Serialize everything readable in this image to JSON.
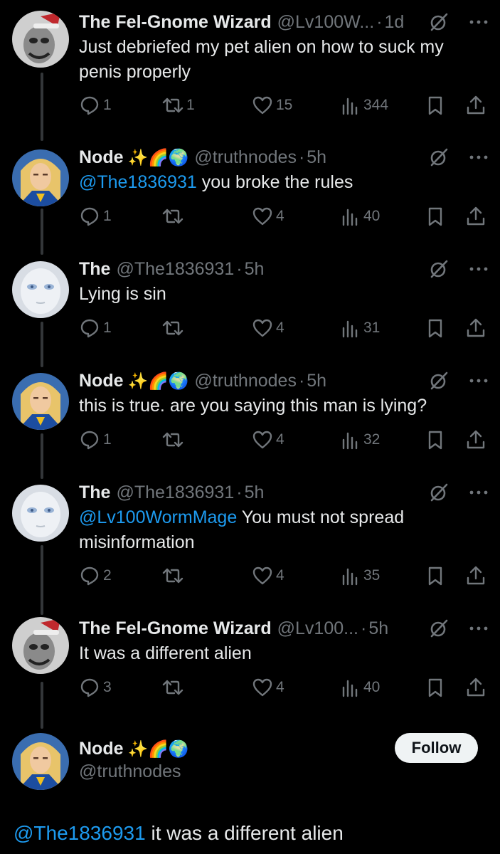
{
  "tweets": [
    {
      "avatar": "goblin-avatar",
      "name": "The Fel-Gnome Wizard",
      "emoji": "",
      "handle": "@Lv100W...",
      "time": "1d",
      "mention": "",
      "text": "Just debriefed my pet alien on how to suck my penis properly",
      "replies": "1",
      "reposts": "1",
      "likes": "15",
      "views": "344"
    },
    {
      "avatar": "node-avatar",
      "name": "Node",
      "emoji": "✨🌈🌍",
      "handle": "@truthnodes",
      "time": "5h",
      "mention": "@The1836931",
      "text": " you broke the rules",
      "replies": "1",
      "reposts": "",
      "likes": "4",
      "views": "40"
    },
    {
      "avatar": "pale-face-avatar",
      "name": "The",
      "emoji": "",
      "handle": "@The1836931",
      "time": "5h",
      "mention": "",
      "text": "Lying is sin",
      "replies": "1",
      "reposts": "",
      "likes": "4",
      "views": "31"
    },
    {
      "avatar": "node-avatar",
      "name": "Node",
      "emoji": "✨🌈🌍",
      "handle": "@truthnodes",
      "time": "5h",
      "mention": "",
      "text": "this is true. are you saying this man is lying?",
      "replies": "1",
      "reposts": "",
      "likes": "4",
      "views": "32"
    },
    {
      "avatar": "pale-face-avatar",
      "name": "The",
      "emoji": "",
      "handle": "@The1836931",
      "time": "5h",
      "mention": "@Lv100WormMage",
      "text": " You must not spread misinformation",
      "replies": "2",
      "reposts": "",
      "likes": "4",
      "views": "35"
    },
    {
      "avatar": "goblin-avatar",
      "name": "The Fel-Gnome Wizard",
      "emoji": "",
      "handle": "@Lv100...",
      "time": "5h",
      "mention": "",
      "text": "It was a different alien",
      "replies": "3",
      "reposts": "",
      "likes": "4",
      "views": "40"
    }
  ],
  "focused": {
    "avatar": "node-avatar",
    "name": "Node",
    "emoji": "✨🌈🌍",
    "handle": "@truthnodes",
    "follow_label": "Follow",
    "mention": "@The1836931",
    "text": " it was a different alien"
  },
  "colors": {
    "background": "#000000",
    "text": "#e7e9ea",
    "muted": "#71767b",
    "link": "#1d9bf0",
    "follow_button": "#eff3f4"
  }
}
